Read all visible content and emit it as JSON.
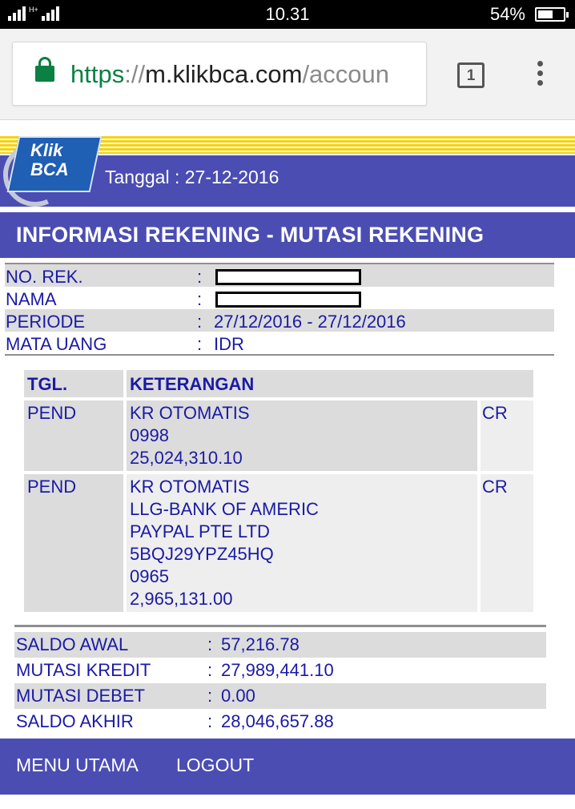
{
  "status_bar": {
    "network": "H+",
    "time": "10.31",
    "battery_percent": "54%"
  },
  "browser": {
    "url_scheme": "https",
    "url_separator": "://",
    "url_host": "m.klikbca.com",
    "url_path": "/accoun",
    "tab_count": "1",
    "lock_icon": "lock-icon",
    "menu_icon": "kebab-menu-icon"
  },
  "header": {
    "logo_line1": "Klik",
    "logo_line2": "BCA",
    "tanggal": "Tanggal : 27-12-2016"
  },
  "page_title": "INFORMASI REKENING - MUTASI REKENING",
  "account_info": [
    {
      "label": "NO. REK.",
      "colon": ":",
      "value": ""
    },
    {
      "label": "NAMA",
      "colon": ":",
      "value": ""
    },
    {
      "label": "PERIODE",
      "colon": ":",
      "value": "27/12/2016 - 27/12/2016"
    },
    {
      "label": "MATA UANG",
      "colon": ":",
      "value": "IDR"
    }
  ],
  "transactions": {
    "headers": {
      "date": "TGL.",
      "description": "KETERANGAN"
    },
    "rows": [
      {
        "date": "PEND",
        "lines": [
          "KR OTOMATIS",
          "0998",
          "25,024,310.10"
        ],
        "type": "CR"
      },
      {
        "date": "PEND",
        "lines": [
          "KR OTOMATIS",
          "LLG-BANK OF AMERIC",
          "PAYPAL PTE LTD",
          "5BQJ29YPZ45HQ",
          "0965",
          "2,965,131.00"
        ],
        "type": "CR"
      }
    ]
  },
  "totals": [
    {
      "label": "SALDO AWAL",
      "colon": ":",
      "value": "57,216.78"
    },
    {
      "label": "MUTASI KREDIT",
      "colon": ":",
      "value": "27,989,441.10"
    },
    {
      "label": "MUTASI DEBET",
      "colon": ":",
      "value": "0.00"
    },
    {
      "label": "SALDO AKHIR",
      "colon": ":",
      "value": "28,046,657.88"
    }
  ],
  "footer": {
    "menu_utama": "MENU UTAMA",
    "logout": "LOGOUT"
  },
  "colors": {
    "brand_blue": "#4b4db3",
    "text_blue": "#1a1aa6",
    "stripe_yellow": "#f4d20b",
    "secure_green": "#0b8043"
  }
}
